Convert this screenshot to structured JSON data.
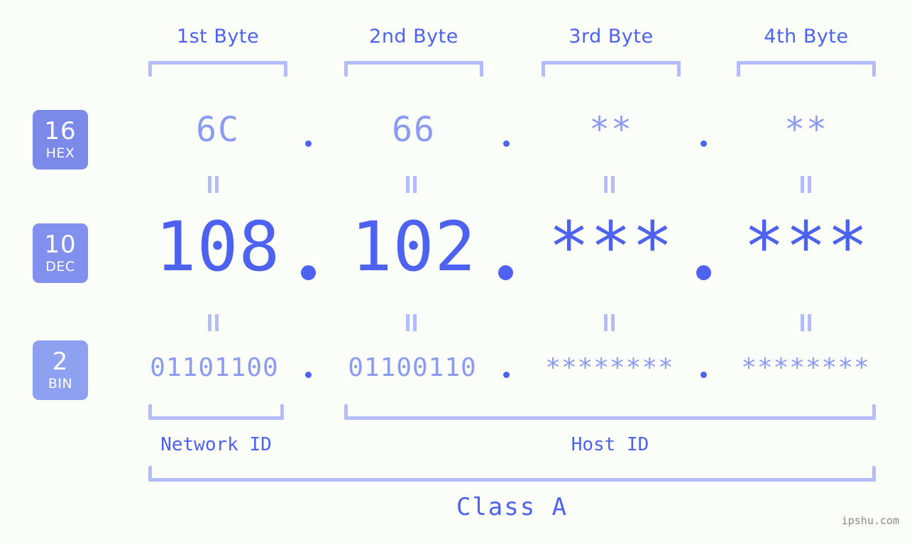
{
  "page": {
    "background": "#fbfdf8",
    "accent_strong": "#4d62ee",
    "accent_light": "#8c9bf2",
    "accent_pale": "#b3bdfb",
    "watermark": "ipshu.com"
  },
  "byte_headers": [
    {
      "label": "1st Byte"
    },
    {
      "label": "2nd Byte"
    },
    {
      "label": "3rd Byte"
    },
    {
      "label": "4th Byte"
    }
  ],
  "radix_rows": [
    {
      "badge_number": "16",
      "badge_word": "HEX",
      "badge_color": "#7b8ae8",
      "values": [
        "6C",
        "66",
        "**",
        "**"
      ],
      "separator": "."
    },
    {
      "badge_number": "10",
      "badge_word": "DEC",
      "badge_color": "#8090ec",
      "values": [
        "108",
        "102",
        "***",
        "***"
      ],
      "separator": "."
    },
    {
      "badge_number": "2",
      "badge_word": "BIN",
      "badge_color": "#8ea0f0",
      "values": [
        "01101100",
        "01100110",
        "********",
        "********"
      ],
      "separator": "."
    }
  ],
  "equivalence_marker": "=",
  "regions": [
    {
      "label": "Network ID"
    },
    {
      "label": "Host ID"
    }
  ],
  "class": {
    "label": "Class A"
  }
}
